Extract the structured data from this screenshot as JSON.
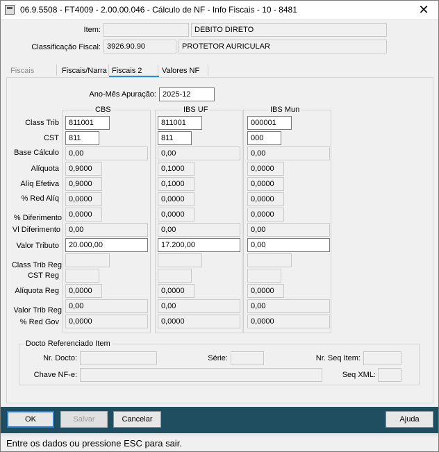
{
  "window": {
    "title": "06.9.5508 - FT4009 - 2.00.00.046 - Cálculo de NF - Info Fiscais - 10 - 8481",
    "close_glyph": "✕"
  },
  "header": {
    "item_label": "Item:",
    "item_code": "",
    "item_desc": "DEBITO DIRETO",
    "classificacao_label": "Classificação Fiscal:",
    "classificacao_code": "3926.90.90",
    "classificacao_desc": "PROTETOR AURICULAR"
  },
  "tabs": [
    {
      "label": "Fiscais",
      "state": "disabled"
    },
    {
      "label": "Fiscais/Narra",
      "state": "normal"
    },
    {
      "label": "Fiscais 2",
      "state": "active"
    },
    {
      "label": "Valores NF",
      "state": "normal"
    }
  ],
  "apuracao": {
    "label": "Ano-Mês Apuração:",
    "value": "2025-12"
  },
  "row_labels": {
    "class_trib": "Class Trib",
    "cst": "CST",
    "base_calculo": "Base Cálculo",
    "aliquota": "Alíquota",
    "aliq_efetiva": "Alíq Efetiva",
    "red_aliq": "% Red Alíq",
    "diferimento": "% Diferimento",
    "vl_diferimento": "Vl Diferimento",
    "valor_tributo": "Valor Tributo",
    "class_trib_reg": "Class Trib Reg",
    "cst_reg": "CST Reg",
    "aliquota_reg": "Alíquota Reg",
    "valor_trib_reg": "Valor Trib Reg",
    "red_gov": "% Red Gov"
  },
  "columns": {
    "cbs": {
      "title": "CBS",
      "class_trib": "811001",
      "cst": "811",
      "base_calculo": "0,00",
      "aliquota": "0,9000",
      "aliq_efetiva": "0,9000",
      "red_aliq": "0,0000",
      "diferimento": "0,0000",
      "vl_diferimento": "0,00",
      "valor_tributo": "20.000,00",
      "class_trib_reg": "",
      "cst_reg": "",
      "aliquota_reg": "0,0000",
      "valor_trib_reg": "0,00",
      "red_gov": "0,0000"
    },
    "ibs_uf": {
      "title": "IBS UF",
      "class_trib": "811001",
      "cst": "811",
      "base_calculo": "0,00",
      "aliquota": "0,1000",
      "aliq_efetiva": "0,1000",
      "red_aliq": "0,0000",
      "diferimento": "0,0000",
      "vl_diferimento": "0,00",
      "valor_tributo": "17.200,00",
      "class_trib_reg": "",
      "cst_reg": "",
      "aliquota_reg": "0,0000",
      "valor_trib_reg": "0,00",
      "red_gov": "0,0000"
    },
    "ibs_mun": {
      "title": "IBS Mun",
      "class_trib": "000001",
      "cst": "000",
      "base_calculo": "0,00",
      "aliquota": "0,0000",
      "aliq_efetiva": "0,0000",
      "red_aliq": "0,0000",
      "diferimento": "0,0000",
      "vl_diferimento": "0,00",
      "valor_tributo": "0,00",
      "class_trib_reg": "",
      "cst_reg": "",
      "aliquota_reg": "0,0000",
      "valor_trib_reg": "0,00",
      "red_gov": "0,0000"
    }
  },
  "docto": {
    "title": "Docto Referenciado Item",
    "nr_docto_label": "Nr. Docto:",
    "nr_docto": "",
    "serie_label": "Série:",
    "serie": "",
    "nr_seq_label": "Nr. Seq Item:",
    "nr_seq": "",
    "chave_label": "Chave NF-e:",
    "chave": "",
    "seq_xml_label": "Seq XML:",
    "seq_xml": ""
  },
  "buttons": {
    "ok": "OK",
    "salvar": "Salvar",
    "cancelar": "Cancelar",
    "ajuda": "Ajuda"
  },
  "status": "Entre os dados ou pressione ESC para sair.",
  "colors": {
    "titlebar": "#ffffff",
    "button_bar": "#1f4e60",
    "tab_accent": "#1e90d8"
  }
}
